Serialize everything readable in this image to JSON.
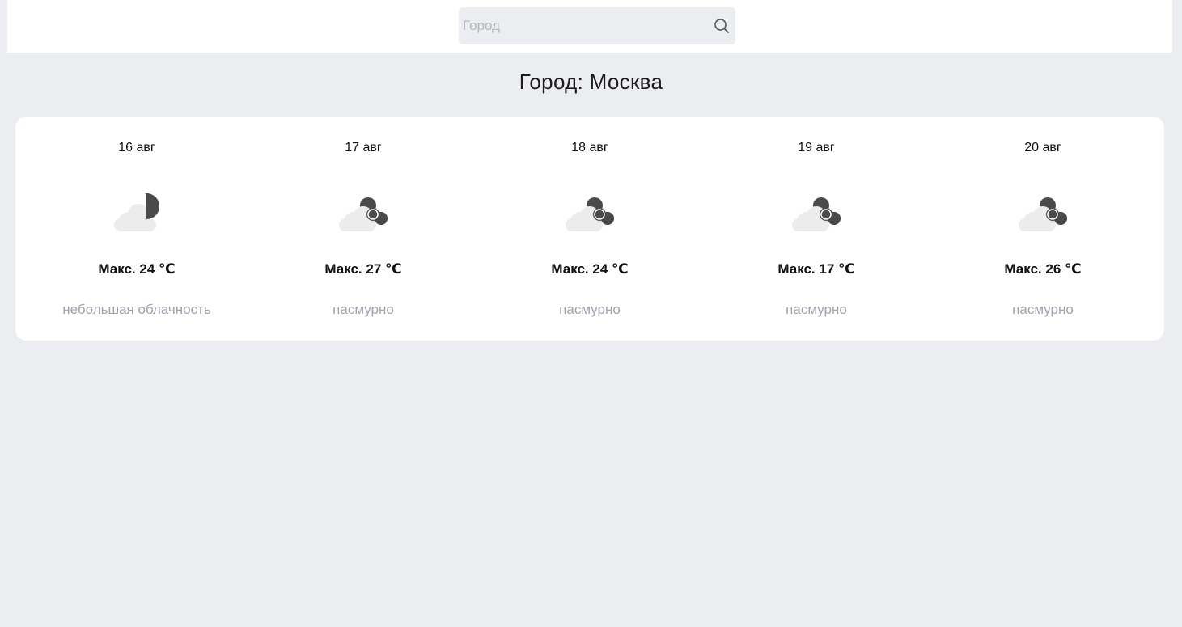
{
  "search": {
    "placeholder": "Город",
    "value": "",
    "icon": "search-icon"
  },
  "city": {
    "title": "Город: Москва"
  },
  "forecast": [
    {
      "date": "16 авг",
      "icon": "moon-cloud-icon",
      "temp": "Макс. 24 ℃",
      "desc": "небольшая облачность"
    },
    {
      "date": "17 авг",
      "icon": "broken-clouds-icon",
      "temp": "Макс. 27 ℃",
      "desc": "пасмурно"
    },
    {
      "date": "18 авг",
      "icon": "broken-clouds-icon",
      "temp": "Макс. 24 ℃",
      "desc": "пасмурно"
    },
    {
      "date": "19 авг",
      "icon": "broken-clouds-icon",
      "temp": "Макс. 17 ℃",
      "desc": "пасмурно"
    },
    {
      "date": "20 авг",
      "icon": "broken-clouds-icon",
      "temp": "Макс. 26 ℃",
      "desc": "пасмурно"
    }
  ],
  "colors": {
    "background": "#ecedf1",
    "card": "#ffffff",
    "cloud_light": "#ececec",
    "cloud_dark": "#4a4a4a",
    "description": "#9ea3ad"
  }
}
